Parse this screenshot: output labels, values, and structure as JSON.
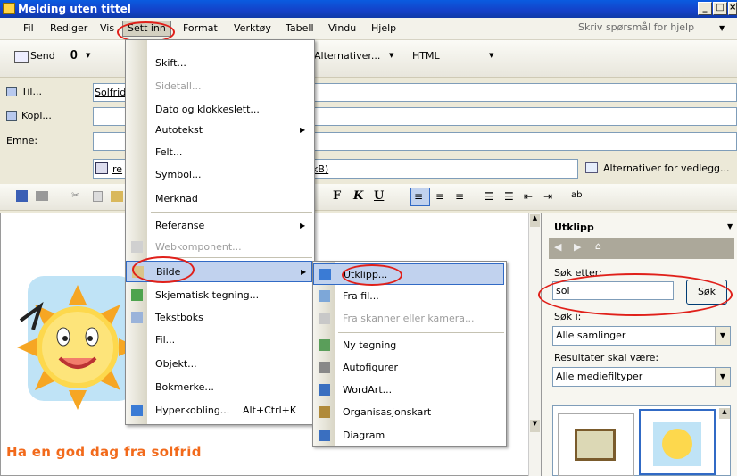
{
  "window": {
    "title": "Melding uten tittel"
  },
  "menubar": {
    "items": [
      "Fil",
      "Rediger",
      "Vis",
      "Sett inn",
      "Format",
      "Verktøy",
      "Tabell",
      "Vindu",
      "Hjelp"
    ],
    "help_placeholder": "Skriv spørsmål for hjelp"
  },
  "toolbar1": {
    "send": "Send",
    "options": "Alternativer...",
    "format": "HTML"
  },
  "fields": {
    "to_label": "Til...",
    "to_value": "Solfrid",
    "cc_label": "Kopi...",
    "subject_label": "Emne:",
    "attachment_prefix": "re",
    "attachment_suffix": "kB)",
    "attach_options": "Alternativer for vedlegg..."
  },
  "format_toolbar": {
    "bold": "F",
    "italic": "K",
    "underline": "U"
  },
  "insert_menu": {
    "items": [
      {
        "label": "Skift...",
        "disabled": false
      },
      {
        "label": "Sidetall...",
        "disabled": true
      },
      {
        "label": "Dato og klokkeslett...",
        "disabled": false
      },
      {
        "label": "Autotekst",
        "disabled": false,
        "submenu": true
      },
      {
        "label": "Felt...",
        "disabled": false
      },
      {
        "label": "Symbol...",
        "disabled": false
      },
      {
        "label": "Merknad",
        "disabled": false
      },
      {
        "label": "Referanse",
        "disabled": false,
        "submenu": true
      },
      {
        "label": "Webkomponent...",
        "disabled": true
      },
      {
        "label": "Bilde",
        "disabled": false,
        "submenu": true,
        "highlighted": true
      },
      {
        "label": "Skjematisk tegning...",
        "disabled": false
      },
      {
        "label": "Tekstboks",
        "disabled": false
      },
      {
        "label": "Fil...",
        "disabled": false
      },
      {
        "label": "Objekt...",
        "disabled": false
      },
      {
        "label": "Bokmerke...",
        "disabled": false
      },
      {
        "label": "Hyperkobling...",
        "disabled": false,
        "shortcut": "Alt+Ctrl+K"
      }
    ]
  },
  "picture_menu": {
    "items": [
      {
        "label": "Utklipp...",
        "disabled": false,
        "highlighted": true
      },
      {
        "label": "Fra fil...",
        "disabled": false
      },
      {
        "label": "Fra skanner eller kamera...",
        "disabled": true
      },
      {
        "label": "Ny tegning",
        "disabled": false
      },
      {
        "label": "Autofigurer",
        "disabled": false
      },
      {
        "label": "WordArt...",
        "disabled": false
      },
      {
        "label": "Organisasjonskart",
        "disabled": false
      },
      {
        "label": "Diagram",
        "disabled": false
      }
    ]
  },
  "document": {
    "text": "Ha en god dag fra solfrid",
    "text_color": "#f26a1b"
  },
  "clipart_pane": {
    "title": "Utklipp",
    "search_label": "Søk etter:",
    "search_value": "sol",
    "search_button": "Søk",
    "search_in_label": "Søk i:",
    "search_in_value": "Alle samlinger",
    "results_label": "Resultater skal være:",
    "results_value": "Alle mediefiltyper"
  },
  "colors": {
    "accent": "#316ac5",
    "highlight": "#c1d2ee",
    "annotation": "#e0201a",
    "title_bar": "#0a5be0"
  }
}
